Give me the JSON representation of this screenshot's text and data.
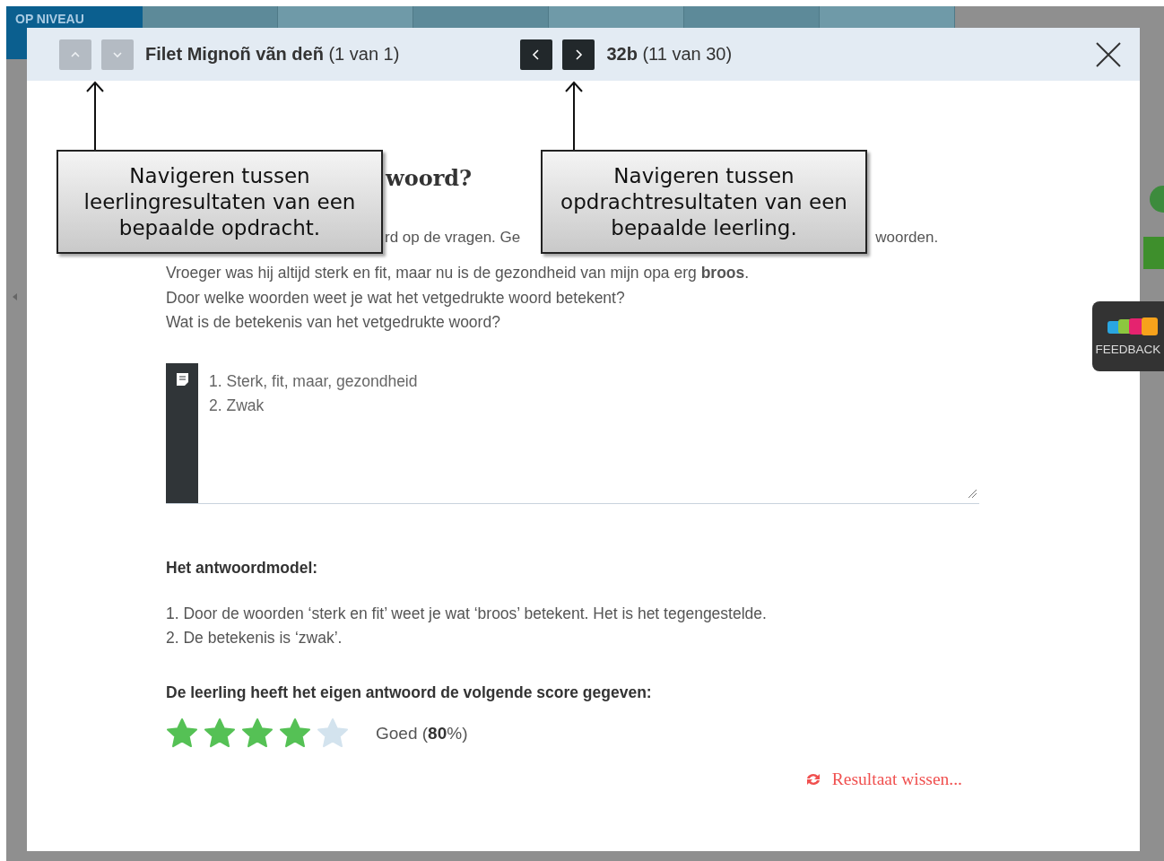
{
  "app_bar": {
    "logo": "OP NIVEAU"
  },
  "dialog": {
    "header": {
      "student_buttons": [
        {
          "kind": "up",
          "disabled": true
        },
        {
          "kind": "down",
          "disabled": true
        }
      ],
      "student_name": "Filet Mignoñ vãn deñ",
      "student_count": "(1 van 1)",
      "task_buttons": [
        {
          "kind": "prev",
          "disabled": false
        },
        {
          "kind": "next",
          "disabled": false
        }
      ],
      "task_name": "32b",
      "task_count": "(11 van 30)"
    },
    "question_title": "woord?",
    "instruction_parts": [
      "rd op de vragen. Ge",
      "woorden."
    ],
    "question_lines": [
      "Vroeger was hij altijd sterk en fit, maar nu is de gezondheid van mijn opa erg **broos**.",
      "Door welke woorden weet je wat het vetgedrukte woord betekent?",
      "Wat is de betekenis van het vetgedrukte woord?"
    ],
    "answer": {
      "value": "1. Sterk, fit, maar, gezondheid\n2. Zwak"
    },
    "model_heading": "Het antwoordmodel:",
    "model_lines": [
      "1. Door de woorden ‘sterk en fit’ weet je wat ‘broos’ betekent. Het is het tegengestelde.",
      "2. De betekenis is ‘zwak’."
    ],
    "score_heading": "De leerling heeft het eigen antwoord de volgende score gegeven:",
    "score": {
      "stars": 4,
      "label": "Goed (**80**%)"
    },
    "reset_link": "Resultaat wissen..."
  },
  "callouts": [
    "Navigeren tussen leerlingresultaten van een bepaalde opdracht.",
    "Navigeren tussen opdrachtresultaten van een bepaalde leerling."
  ],
  "feedback_tab": {
    "label": "FEEDBACK"
  }
}
